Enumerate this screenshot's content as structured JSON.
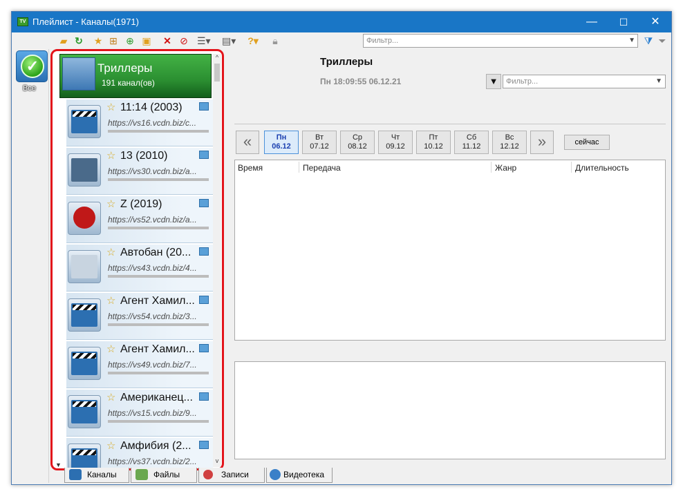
{
  "window": {
    "title": "Плейлист - Каналы(1971)",
    "app_icon": "TV"
  },
  "window_controls": {
    "minimize": "—",
    "maximize": "☐",
    "close": "✕"
  },
  "toolbar": {
    "filter_placeholder": "Фильтр...",
    "icons": [
      "open-folder-icon",
      "refresh-icon",
      "star-icon",
      "tree-icon",
      "add-icon",
      "folder-star-icon",
      "delete-icon",
      "block-icon",
      "list-view-icon",
      "panel-view-icon",
      "help-icon",
      "lock-icon",
      "filter-clear-icon",
      "filter-icon"
    ]
  },
  "sidebar": {
    "all_label": "Все"
  },
  "group": {
    "name": "Триллеры",
    "count": "191 канал(ов)"
  },
  "channels": [
    {
      "name": "11:14 (2003)",
      "url": "https://vs16.vcdn.biz/c..."
    },
    {
      "name": "13 (2010)",
      "url": "https://vs30.vcdn.biz/a..."
    },
    {
      "name": "Z (2019)",
      "url": "https://vs52.vcdn.biz/a..."
    },
    {
      "name": "Автобан (20...",
      "url": "https://vs43.vcdn.biz/4..."
    },
    {
      "name": "Агент Хамил...",
      "url": "https://vs54.vcdn.biz/3..."
    },
    {
      "name": "Агент Хамил...",
      "url": "https://vs49.vcdn.biz/7..."
    },
    {
      "name": "Американец...",
      "url": "https://vs15.vcdn.biz/9..."
    },
    {
      "name": "Амфибия (2...",
      "url": "https://vs37.vcdn.biz/2..."
    }
  ],
  "epg": {
    "title": "Триллеры",
    "datetime": "Пн 18:09:55 06.12.21",
    "filter_placeholder": "Фильтр...",
    "days": [
      {
        "dow": "Пн",
        "date": "06.12"
      },
      {
        "dow": "Вт",
        "date": "07.12"
      },
      {
        "dow": "Ср",
        "date": "08.12"
      },
      {
        "dow": "Чт",
        "date": "09.12"
      },
      {
        "dow": "Пт",
        "date": "10.12"
      },
      {
        "dow": "Сб",
        "date": "11.12"
      },
      {
        "dow": "Вс",
        "date": "12.12"
      }
    ],
    "now_label": "сейчас",
    "columns": [
      "Время",
      "Передача",
      "Жанр",
      "Длительность"
    ]
  },
  "tabs": [
    "Каналы",
    "Файлы",
    "Записи",
    "Видеотека"
  ],
  "colors": {
    "accent": "#1976c6",
    "group_green": "#2b8f31",
    "highlight_red": "#e3141b"
  }
}
